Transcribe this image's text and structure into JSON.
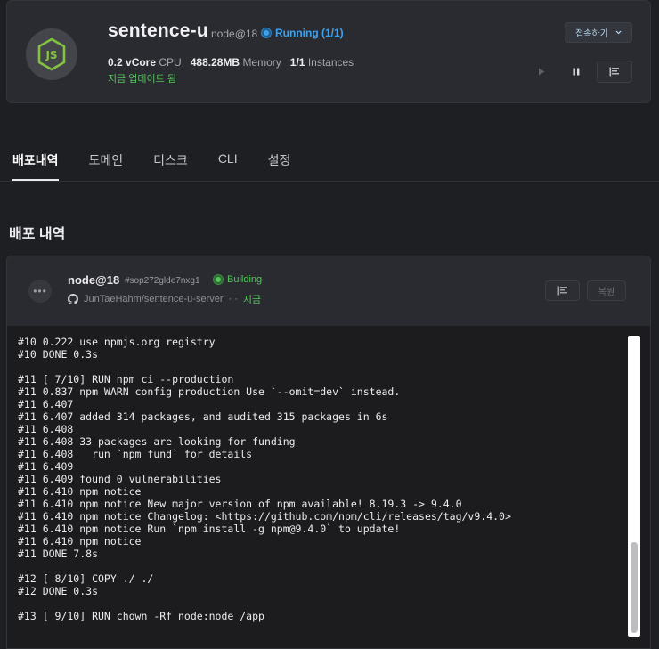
{
  "app": {
    "name": "sentence-u",
    "runtime": "node@18",
    "status": "Running (1/1)",
    "cpu_value": "0.2 vCore",
    "cpu_label": "CPU",
    "memory_value": "488.28MB",
    "memory_label": "Memory",
    "instances_value": "1/1",
    "instances_label": "Instances",
    "updated": "지금 업데이트 됨",
    "connect_label": "접속하기",
    "logo_icon": "nodejs-logo"
  },
  "tabs": [
    {
      "label": "배포내역",
      "active": true
    },
    {
      "label": "도메인"
    },
    {
      "label": "디스크"
    },
    {
      "label": "CLI"
    },
    {
      "label": "설정"
    }
  ],
  "section_title": "배포 내역",
  "deployment": {
    "runtime": "node@18",
    "hash": "#sop272glde7nxg1",
    "status": "Building",
    "repo": "JunTaeHahm/sentence-u-server",
    "repo_suffix": "· ·",
    "time": "지금",
    "restore_label": "복원",
    "log_lines": [
      "#10 0.222 use npmjs.org registry",
      "#10 DONE 0.3s",
      "",
      "#11 [ 7/10] RUN npm ci --production",
      "#11 0.837 npm WARN config production Use `--omit=dev` instead.",
      "#11 6.407",
      "#11 6.407 added 314 packages, and audited 315 packages in 6s",
      "#11 6.408",
      "#11 6.408 33 packages are looking for funding",
      "#11 6.408   run `npm fund` for details",
      "#11 6.409",
      "#11 6.409 found 0 vulnerabilities",
      "#11 6.410 npm notice",
      "#11 6.410 npm notice New major version of npm available! 8.19.3 -> 9.4.0",
      "#11 6.410 npm notice Changelog: <https://github.com/npm/cli/releases/tag/v9.4.0>",
      "#11 6.410 npm notice Run `npm install -g npm@9.4.0` to update!",
      "#11 6.410 npm notice",
      "#11 DONE 7.8s",
      "",
      "#12 [ 8/10] COPY ./ ./",
      "#12 DONE 0.3s",
      "",
      "#13 [ 9/10] RUN chown -Rf node:node /app"
    ]
  },
  "colors": {
    "background": "#1e1f23",
    "card": "#2a2b30",
    "running": "#3ea1ee",
    "green": "#57c35e",
    "terminal": "#1c1c1f"
  }
}
